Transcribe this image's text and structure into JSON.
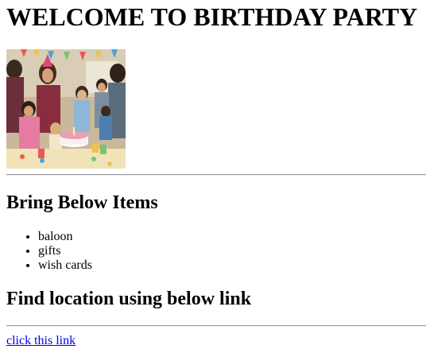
{
  "page": {
    "heading": "WELCOME TO BIRTHDAY PARTY",
    "image_alt": "Family celebrating a child's birthday with a cake"
  },
  "items_section": {
    "title": "Bring Below Items",
    "items": [
      "baloon",
      "gifts",
      "wish cards"
    ]
  },
  "location_section": {
    "title": "Find location using below link",
    "link_text": "click this link"
  },
  "colors": {
    "link": "#0000ee",
    "rule": "#9a9a9a"
  }
}
